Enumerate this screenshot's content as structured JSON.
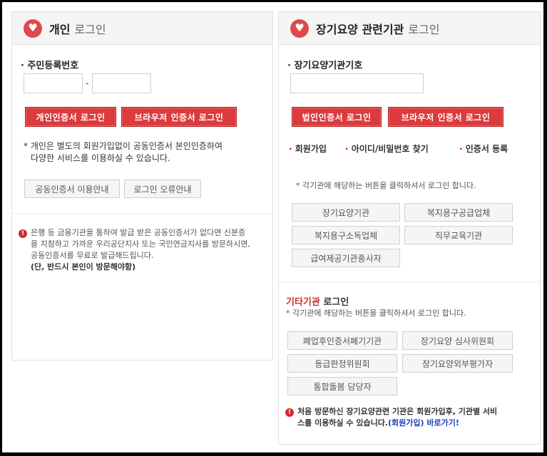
{
  "left": {
    "title": "개인",
    "subtitle": "로그인",
    "field_label": "주민등록번호",
    "dash": "-",
    "buttons": {
      "personal_cert": "개인인증서 로그인",
      "browser_cert": "브라우저 인증서 로그인"
    },
    "notice_line1": "* 개인은 별도의 회원가입없이 공동인증서 본인인증하여",
    "notice_line2": "다양한 서비스를 이용하실 수 있습니다.",
    "gray_buttons": {
      "cert_guide": "공동인증서 이용안내",
      "error_guide": "로그인 오류안내"
    },
    "warning_lines": [
      "은행 등 금융기관을 통하여 발급 받은 공동인증서가 없다면 신분증",
      "을 지참하고 가까운 우리공단지사 또는 국민연금지사를 방문하시면,",
      "공동인증서를 무료로 발급해드립니다."
    ],
    "warning_bold": "(단, 반드시 본인이 방문해야함)"
  },
  "right": {
    "title": "장기요양 관련기관",
    "subtitle": "로그인",
    "field_label": "장기요양기관기호",
    "buttons": {
      "corp_cert": "법인인증서 로그인",
      "browser_cert": "브라우저 인증서 로그인"
    },
    "links": [
      "회원가입",
      "아이디/비밀번호 찾기",
      "인증서 등록"
    ],
    "org_notice": "* 각기관에 해당하는 버튼을 클릭하셔서 로그인 합니다.",
    "org_buttons": [
      "장기요양기관",
      "복지용구공급업체",
      "복지용구소독업체",
      "직무교육기관",
      "급여제공기관종사자"
    ],
    "etc_title_red": "기타기관",
    "etc_title_dark": "로그인",
    "etc_notice": "* 각기관에 해당하는 버튼을 클릭하셔서 로그인 합니다.",
    "etc_buttons": [
      "폐업후인증서폐기기관",
      "장기요양 심사위원회",
      "등급판정위원회",
      "장기요양외부평가자",
      "통합돌봄 담당자"
    ],
    "footer_line1": "처음 방문하신 장기요양관련 기관은 회원가입후, 기관별 서비",
    "footer_line2_a": "스를 이용하실 수 있습니다.",
    "footer_link": "(회원가입) 바로가기!"
  },
  "colors": {
    "accent_red": "#dc3a3d",
    "link_blue": "#1a3fbf"
  }
}
